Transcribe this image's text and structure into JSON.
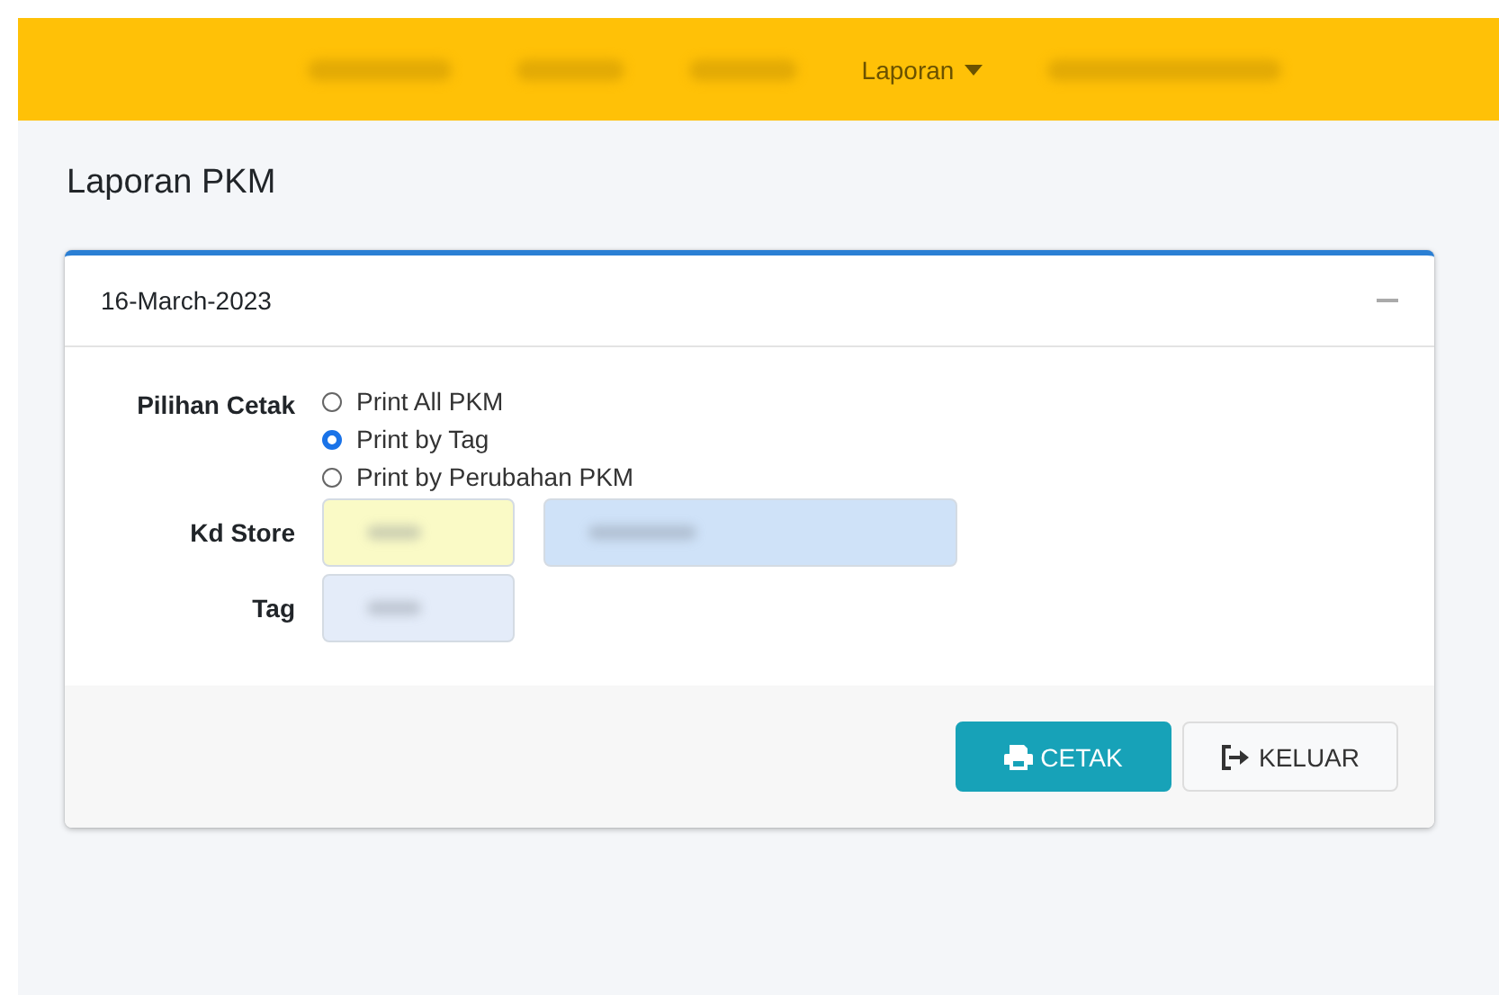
{
  "navbar": {
    "items": [
      {
        "blurred": true
      },
      {
        "blurred": true
      },
      {
        "blurred": true
      },
      {
        "label": "Laporan",
        "blurred": false
      },
      {
        "blurred": true
      }
    ]
  },
  "page_title": "Laporan PKM",
  "card": {
    "date": "16-March-2023",
    "print_option": {
      "label": "Pilihan Cetak",
      "options": [
        {
          "label": "Print All PKM",
          "selected": false
        },
        {
          "label": "Print by Tag",
          "selected": true
        },
        {
          "label": "Print by Perubahan PKM",
          "selected": false
        }
      ]
    },
    "fields": [
      {
        "label": "Kd Store",
        "inputs": [
          {
            "color": "#fafac6",
            "blurred": true,
            "kind": "code"
          },
          {
            "color": "#cfe2f8",
            "blurred": true,
            "kind": "name"
          }
        ]
      },
      {
        "label": "Tag",
        "inputs": [
          {
            "color": "#e4ecf9",
            "blurred": true,
            "kind": "code"
          }
        ]
      }
    ],
    "buttons": [
      {
        "label": "CETAK",
        "kind": "print"
      },
      {
        "label": "KELUAR",
        "kind": "exit"
      }
    ]
  }
}
